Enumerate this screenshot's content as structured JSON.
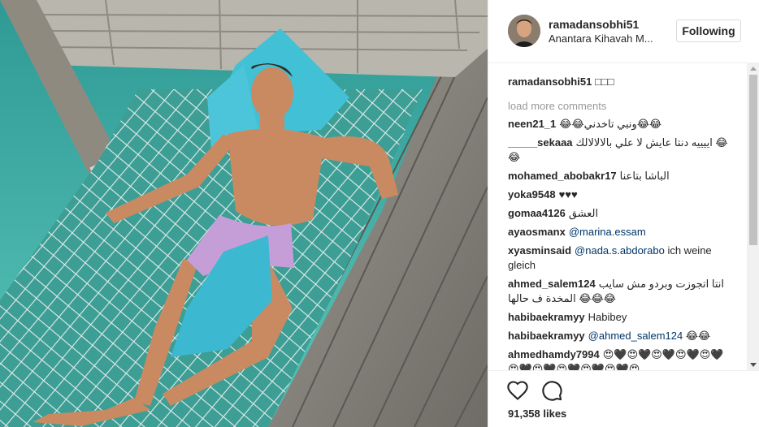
{
  "header": {
    "username": "ramadansobhi51",
    "location": "Anantara Kihavah M...",
    "follow_label": "Following"
  },
  "caption": {
    "username": "ramadansobhi51",
    "text": "□□□"
  },
  "load_more_label": "load more comments",
  "comments": [
    {
      "user": "neen21_1",
      "text": "😂😂ونبي تاخدني😂😂"
    },
    {
      "user": "_____sekaaa",
      "text": "اييييه دنتا عايش لا علي بالالالالك 😂😂"
    },
    {
      "user": "mohamed_abobakr17",
      "text": "الباشا بتاعنا"
    },
    {
      "user": "yoka9548",
      "text": "♥♥♥"
    },
    {
      "user": "gomaa4126",
      "text": "العشق"
    },
    {
      "user": "ayaosmanx",
      "mention": "@marina.essam",
      "text": ""
    },
    {
      "user": "xyasminsaid",
      "mention": "@nada.s.abdorabo",
      "text": "ich weine gleich"
    },
    {
      "user": "ahmed_salem124",
      "text": "انتا اتجوزت وبردو مش سايب المخدة ف حالها 😂😂😂"
    },
    {
      "user": "habibaekramyy",
      "text": "Habibey"
    },
    {
      "user": "habibaekramyy",
      "mention": "@ahmed_salem124",
      "text": "😂😂"
    },
    {
      "user": "ahmedhamdy7994",
      "text": "😍🖤😍🖤😍🖤😍🖤😍🖤😍🖤😍🖤😍🖤😍🖤😍🖤😍"
    }
  ],
  "likes_label": "91,358 likes",
  "icons": {
    "like": "heart-icon",
    "comment": "speech-bubble-icon"
  },
  "colors": {
    "mention": "#003569",
    "muted": "#999999",
    "text": "#262626"
  }
}
